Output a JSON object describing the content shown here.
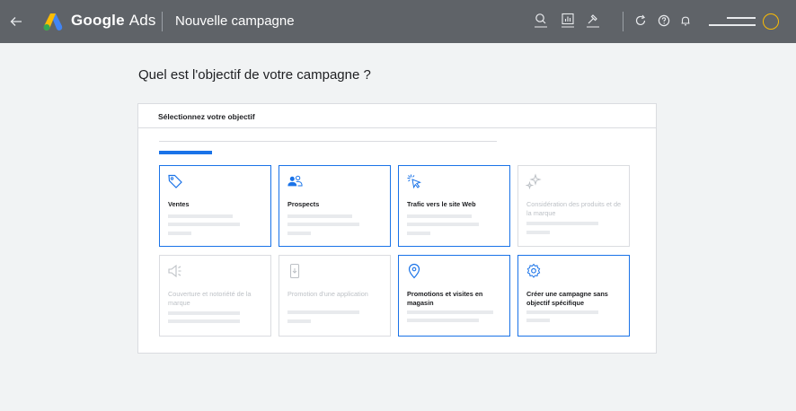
{
  "topbar": {
    "back_icon": "arrow-left-icon",
    "brand_g": "Google",
    "brand_ads": "Ads",
    "title": "Nouvelle campagne",
    "icons": [
      "search-icon",
      "reports-icon",
      "tools-icon",
      "refresh-icon",
      "help-icon",
      "notifications-icon"
    ]
  },
  "page": {
    "heading": "Quel est l'objectif de votre campagne ?"
  },
  "card": {
    "header": "Sélectionnez votre objectif"
  },
  "tiles": [
    {
      "label": "Ventes",
      "icon": "tag-icon",
      "state": "active"
    },
    {
      "label": "Prospects",
      "icon": "people-icon",
      "state": "active"
    },
    {
      "label": "Trafic vers le site Web",
      "icon": "cursor-click-icon",
      "state": "active"
    },
    {
      "label": "Considération des produits et de la marque",
      "icon": "sparkle-icon",
      "state": "disabled"
    },
    {
      "label": "Couverture et notoriété de la marque",
      "icon": "megaphone-icon",
      "state": "disabled"
    },
    {
      "label": "Promotion d'une application",
      "icon": "phone-download-icon",
      "state": "disabled"
    },
    {
      "label": "Promotions et visites en magasin",
      "icon": "location-pin-icon",
      "state": "active"
    },
    {
      "label": "Créer une campagne sans objectif spécifique",
      "icon": "gear-icon",
      "state": "active"
    }
  ],
  "colors": {
    "topbar": "#5f6368",
    "accent": "#1a73e8",
    "avatar_ring": "#fbbc04",
    "background": "#f1f3f4"
  }
}
